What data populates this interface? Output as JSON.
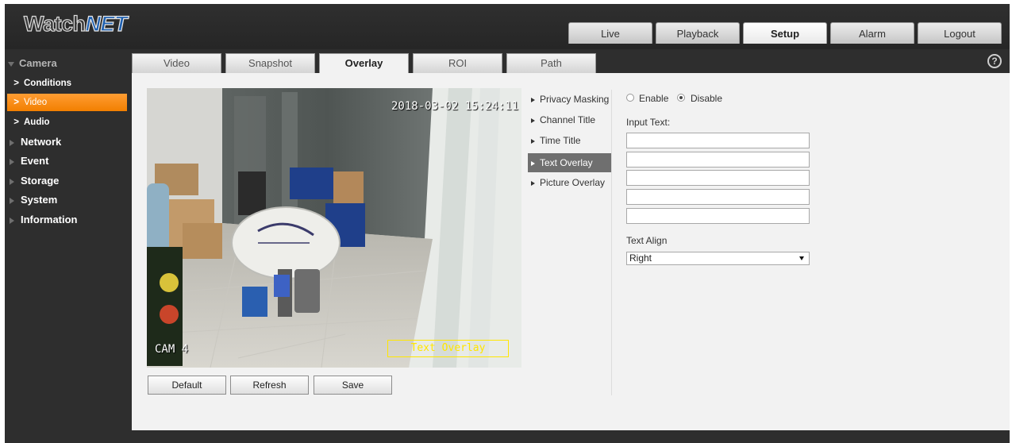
{
  "brand": {
    "logo_part1": "Watch",
    "logo_part2": "NET"
  },
  "top_nav": {
    "tabs": [
      {
        "label": "Live",
        "active": false
      },
      {
        "label": "Playback",
        "active": false
      },
      {
        "label": "Setup",
        "active": true
      },
      {
        "label": "Alarm",
        "active": false
      },
      {
        "label": "Logout",
        "active": false
      }
    ]
  },
  "sidebar": {
    "items": [
      {
        "label": "Camera",
        "expanded": true
      },
      {
        "label": "Conditions",
        "sub": true
      },
      {
        "label": "Video",
        "sub": true,
        "selected": true
      },
      {
        "label": "Audio",
        "sub": true
      },
      {
        "label": "Network"
      },
      {
        "label": "Event"
      },
      {
        "label": "Storage"
      },
      {
        "label": "System"
      },
      {
        "label": "Information"
      }
    ]
  },
  "sub_tabs": {
    "tabs": [
      {
        "label": "Video",
        "active": false
      },
      {
        "label": "Snapshot",
        "active": false
      },
      {
        "label": "Overlay",
        "active": true
      },
      {
        "label": "ROI",
        "active": false
      },
      {
        "label": "Path",
        "active": false
      }
    ],
    "help_icon": "help-icon"
  },
  "preview": {
    "timestamp": "2018-03-02 15:24:11",
    "camera_name": "CAM 4",
    "text_overlay": "Text Overlay"
  },
  "buttons": {
    "default": "Default",
    "refresh": "Refresh",
    "save": "Save"
  },
  "overlay_menu": {
    "items": [
      {
        "label": "Privacy Masking",
        "active": false
      },
      {
        "label": "Channel Title",
        "active": false
      },
      {
        "label": "Time Title",
        "active": false
      },
      {
        "label": "Text Overlay",
        "active": true
      },
      {
        "label": "Picture Overlay",
        "active": false
      }
    ]
  },
  "form": {
    "enable_label": "Enable",
    "disable_label": "Disable",
    "selected": "Disable",
    "input_text_label": "Input Text:",
    "inputs": [
      "",
      "",
      "",
      "",
      ""
    ],
    "text_align_label": "Text Align",
    "text_align_value": "Right"
  },
  "colors": {
    "accent": "#f28a1a",
    "chrome": "#2e2e2e",
    "panel": "#f2f2f2",
    "overlay_box": "#ffe600"
  }
}
